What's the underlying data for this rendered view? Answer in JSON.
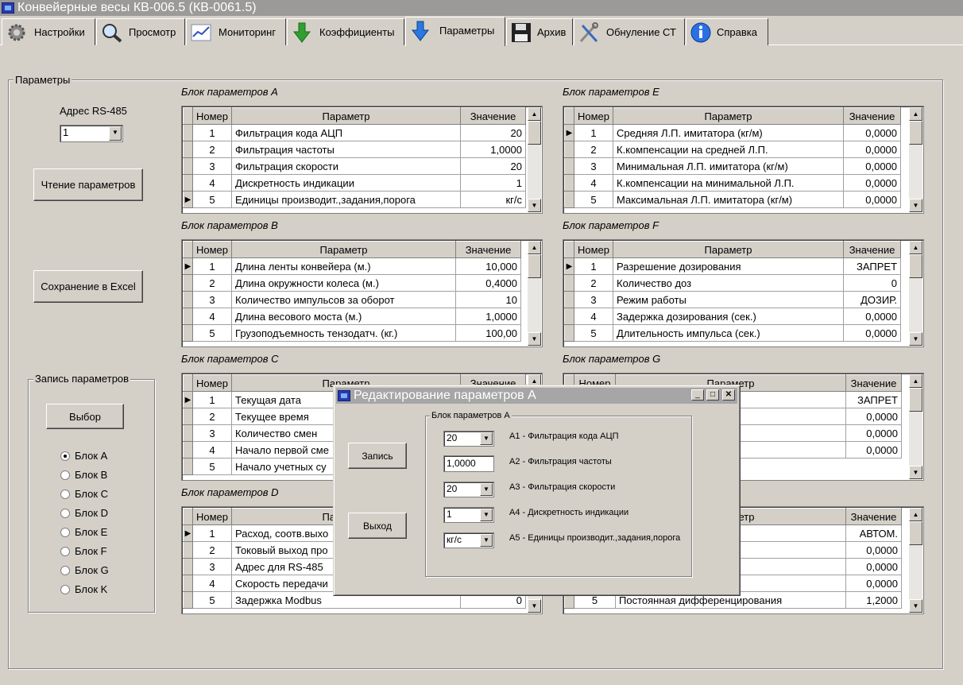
{
  "window": {
    "title": "Конвейерные весы КВ-006.5 (КВ-0061.5)"
  },
  "tabs": [
    {
      "label": "Настройки",
      "icon": "gear-icon"
    },
    {
      "label": "Просмотр",
      "icon": "magnifier-icon"
    },
    {
      "label": "Мониторинг",
      "icon": "chart-icon"
    },
    {
      "label": "Коэффициенты",
      "icon": "green-arrow-down-icon"
    },
    {
      "label": "Параметры",
      "icon": "blue-arrow-down-icon"
    },
    {
      "label": "Архив",
      "icon": "floppy-disk-icon"
    },
    {
      "label": "Обнуление СТ",
      "icon": "tools-icon"
    },
    {
      "label": "Справка",
      "icon": "info-icon"
    }
  ],
  "params_group": {
    "title": "Параметры"
  },
  "rs485": {
    "label": "Адрес RS-485",
    "value": "1"
  },
  "buttons": {
    "read": "Чтение параметров",
    "save_excel": "Сохранение в Excel",
    "select": "Выбор"
  },
  "write_group": {
    "title": "Запись параметров",
    "radios": [
      "Блок A",
      "Блок B",
      "Блок C",
      "Блок D",
      "Блок E",
      "Блок F",
      "Блок G",
      "Блок K"
    ],
    "selected": 0
  },
  "headers": {
    "num": "Номер",
    "param": "Параметр",
    "value": "Значение"
  },
  "blocks": {
    "A": {
      "caption": "Блок параметров А",
      "rows": [
        [
          "1",
          "Фильтрация кода АЦП",
          "20"
        ],
        [
          "2",
          "Фильтрация частоты",
          "1,0000"
        ],
        [
          "3",
          "Фильтрация скорости",
          "20"
        ],
        [
          "4",
          "Дискретность индикации",
          "1"
        ],
        [
          "5",
          "Единицы производит.,задания,порога",
          "кг/с"
        ]
      ]
    },
    "B": {
      "caption": "Блок параметров B",
      "rows": [
        [
          "1",
          "Длина ленты конвейера (м.)",
          "10,000"
        ],
        [
          "2",
          "Длина окружности колеса (м.)",
          "0,4000"
        ],
        [
          "3",
          "Количество импульсов за оборот",
          "10"
        ],
        [
          "4",
          "Длина весового моста (м.)",
          "1,0000"
        ],
        [
          "5",
          "Грузоподъемность тензодатч. (кг.)",
          "100,00"
        ]
      ]
    },
    "C": {
      "caption": "Блок параметров C",
      "rows": [
        [
          "1",
          "Текущая дата",
          ""
        ],
        [
          "2",
          "Текущее время",
          ""
        ],
        [
          "3",
          "Количество смен",
          ""
        ],
        [
          "4",
          "Начало первой сме",
          ""
        ],
        [
          "5",
          "Начало учетных су",
          ""
        ]
      ]
    },
    "D": {
      "caption": "Блок параметров D",
      "rows": [
        [
          "1",
          "Расход, соотв.выхо",
          ""
        ],
        [
          "2",
          "Токовый выход про",
          ""
        ],
        [
          "3",
          "Адрес для RS-485",
          ""
        ],
        [
          "4",
          "Скорость передачи",
          ""
        ],
        [
          "5",
          "Задержка Modbus",
          "0"
        ]
      ]
    },
    "E": {
      "caption": "Блок параметров E",
      "rows": [
        [
          "1",
          "Средняя Л.П. имитатора (кг/м)",
          "0,0000"
        ],
        [
          "2",
          "К.компенсации на средней Л.П.",
          "0,0000"
        ],
        [
          "3",
          "Минимальная Л.П. имитатора (кг/м)",
          "0,0000"
        ],
        [
          "4",
          "К.компенсации на минимальной Л.П.",
          "0,0000"
        ],
        [
          "5",
          "Максимальная Л.П. имитатора (кг/м)",
          "0,0000"
        ]
      ]
    },
    "F": {
      "caption": "Блок параметров F",
      "rows": [
        [
          "1",
          "Разрешение дозирования",
          "ЗАПРЕТ"
        ],
        [
          "2",
          "Количество доз",
          "0"
        ],
        [
          "3",
          "Режим работы",
          "ДОЗИР."
        ],
        [
          "4",
          "Задержка дозирования (сек.)",
          "0,0000"
        ],
        [
          "5",
          "Длительность импульса (сек.)",
          "0,0000"
        ]
      ]
    },
    "G": {
      "caption": "Блок параметров G",
      "rows": [
        [
          "1",
          "ия",
          "ЗАПРЕТ"
        ],
        [
          "2",
          "к, т/час)",
          "0,0000"
        ],
        [
          "3",
          "ек, т/час)",
          "0,0000"
        ],
        [
          "4",
          "(сек.)",
          "0,0000"
        ]
      ]
    },
    "K": {
      "rows": [
        [
          "1",
          "улятора",
          "АВТОМ."
        ],
        [
          "2",
          "ек,т/час (%)",
          "0,0000"
        ],
        [
          "3",
          "регулятора",
          "0,0000"
        ],
        [
          "4",
          "ания",
          "0,0000"
        ],
        [
          "5",
          "Постоянная дифференцирования",
          "1,2000"
        ]
      ]
    }
  },
  "dialog": {
    "title": "Редактирование параметров А",
    "write_button": "Запись",
    "exit_button": "Выход",
    "group_title": "Блок параметров А",
    "fields": [
      {
        "value": "20",
        "label": "А1 - Фильтрация кода АЦП"
      },
      {
        "value": "1,0000",
        "label": "А2 - Фильтрация частоты"
      },
      {
        "value": "20",
        "label": "А3 - Фильтрация скорости"
      },
      {
        "value": "1",
        "label": "А4 - Дискретность индикации"
      },
      {
        "value": "кг/с",
        "label": "А5 - Единицы производит.,задания,порога"
      }
    ]
  }
}
